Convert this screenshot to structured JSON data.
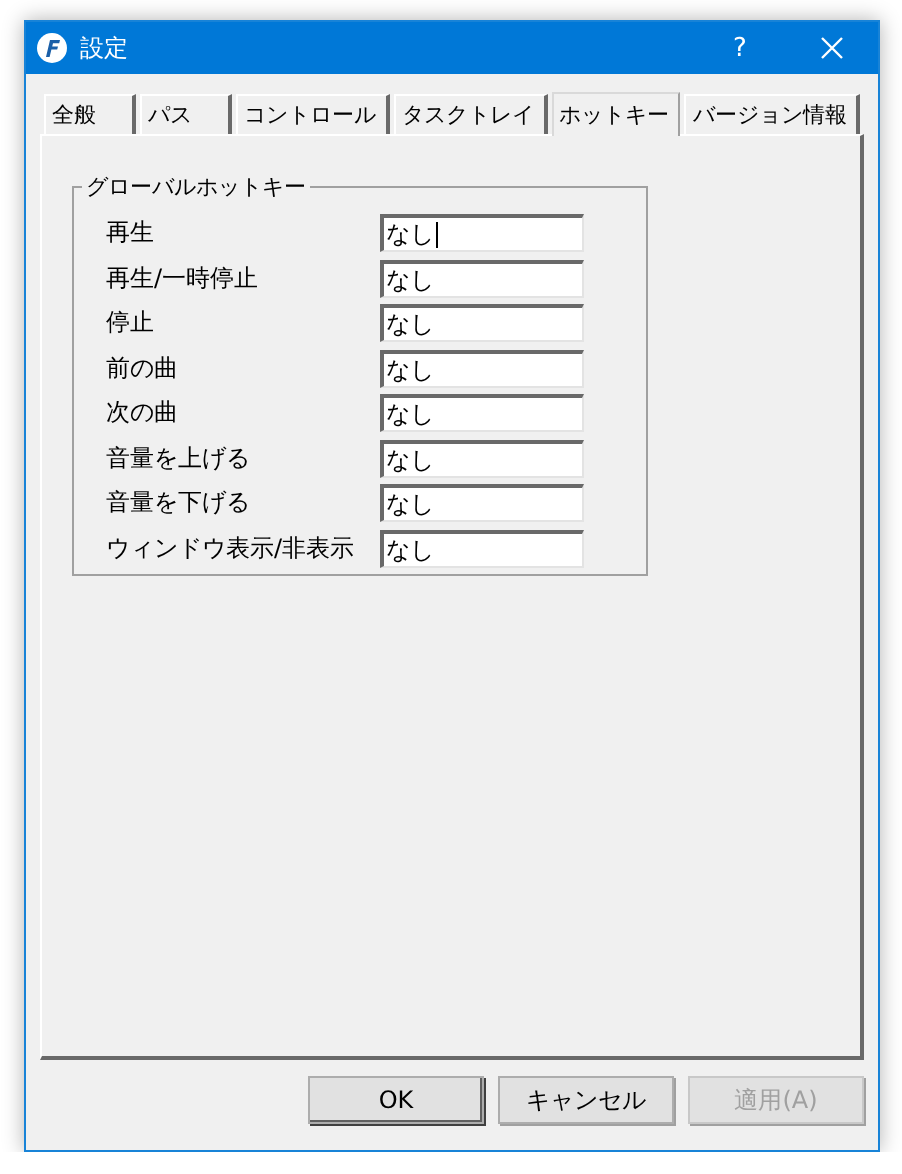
{
  "window": {
    "title": "設定",
    "help": "?"
  },
  "tabs": [
    {
      "label": "全般",
      "selected": false
    },
    {
      "label": "パス",
      "selected": false
    },
    {
      "label": "コントロール",
      "selected": false
    },
    {
      "label": "タスクトレイ",
      "selected": false
    },
    {
      "label": "ホットキー",
      "selected": true
    },
    {
      "label": "バージョン情報",
      "selected": false
    }
  ],
  "group": {
    "title": "グローバルホットキー",
    "rows": [
      {
        "label": "再生",
        "value": "なし",
        "focused": true
      },
      {
        "label": "再生/一時停止",
        "value": "なし",
        "focused": false
      },
      {
        "label": "停止",
        "value": "なし",
        "focused": false
      },
      {
        "label": "前の曲",
        "value": "なし",
        "focused": false
      },
      {
        "label": "次の曲",
        "value": "なし",
        "focused": false
      },
      {
        "label": "音量を上げる",
        "value": "なし",
        "focused": false
      },
      {
        "label": "音量を下げる",
        "value": "なし",
        "focused": false
      },
      {
        "label": "ウィンドウ表示/非表示",
        "value": "なし",
        "focused": false
      }
    ]
  },
  "buttons": [
    {
      "label": "OK",
      "disabled": false,
      "default": true
    },
    {
      "label": "キャンセル",
      "disabled": false,
      "default": false
    },
    {
      "label": "適用(A)",
      "disabled": true,
      "default": false
    }
  ]
}
